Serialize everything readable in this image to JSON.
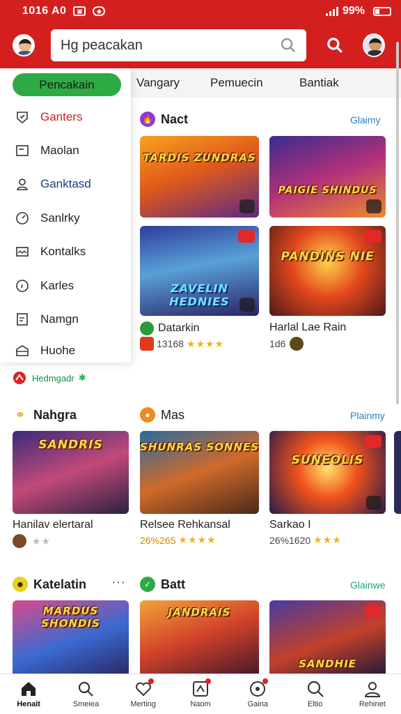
{
  "status_bar": {
    "time": "1016 A0",
    "battery": "99%"
  },
  "header": {
    "search_placeholder": "Hg peacakan",
    "search_icon": "search-icon"
  },
  "sidebar": {
    "pill": "Pencakain",
    "items": [
      {
        "label": "Ganters",
        "icon": "shield-icon"
      },
      {
        "label": "Maolan",
        "icon": "window-icon"
      },
      {
        "label": "Ganktasd",
        "icon": "person-icon"
      },
      {
        "label": "Sanlrky",
        "icon": "gauge-icon"
      },
      {
        "label": "Kontalks",
        "icon": "mail-icon"
      },
      {
        "label": "Karles",
        "icon": "circle-icon"
      },
      {
        "label": "Namgn",
        "icon": "note-icon"
      },
      {
        "label": "Huohe",
        "icon": "box-icon"
      }
    ]
  },
  "tabs": [
    "Vangary",
    "Pemuecin",
    "Bantiak"
  ],
  "new_label": "Hedmgadr",
  "sections": [
    {
      "title": "Nact",
      "more": "Glaimy"
    },
    {
      "title": "Nahgra",
      "more": ""
    },
    {
      "title": "Mas",
      "more": "Plainmy"
    },
    {
      "title": "Katelatin",
      "more": ""
    },
    {
      "title": "Batt",
      "more": "Glainwe"
    }
  ],
  "card_titles": [
    "TARDIS ZUNDRAS",
    "PAIGIE SHINDUS",
    "ZAVELIN HEDNIES",
    "PANDINS NIE",
    "SANDRIS",
    "SHUNRAS SONNES",
    "SUNEOLIS",
    "MARDUS SHONDIS",
    "JANDRAIS",
    "SANDHIE"
  ],
  "games": [
    {
      "name": "Datarkin",
      "meta": "13168"
    },
    {
      "name": "Harlal Lae Rain",
      "meta": "1d6"
    },
    {
      "name": "Hanilav elertaral",
      "meta": ""
    },
    {
      "name": "Relsee Rehkansal",
      "meta": "26%265"
    },
    {
      "name": "Sarkao I",
      "meta": "26%1620"
    }
  ],
  "bottom_nav": [
    {
      "label": "Henait",
      "icon": "home-icon"
    },
    {
      "label": "Smeiea",
      "icon": "search-icon"
    },
    {
      "label": "Merting",
      "icon": "heart-icon"
    },
    {
      "label": "Naom",
      "icon": "game-icon"
    },
    {
      "label": "Gaina",
      "icon": "ball-icon"
    },
    {
      "label": "Eltio",
      "icon": "magnifier-icon"
    },
    {
      "label": "Rehinet",
      "icon": "profile-icon"
    }
  ],
  "colors": {
    "brand": "#d3201f",
    "green": "#2eaa45",
    "link_blue": "#2a7fc4",
    "star": "#f1b50b"
  }
}
